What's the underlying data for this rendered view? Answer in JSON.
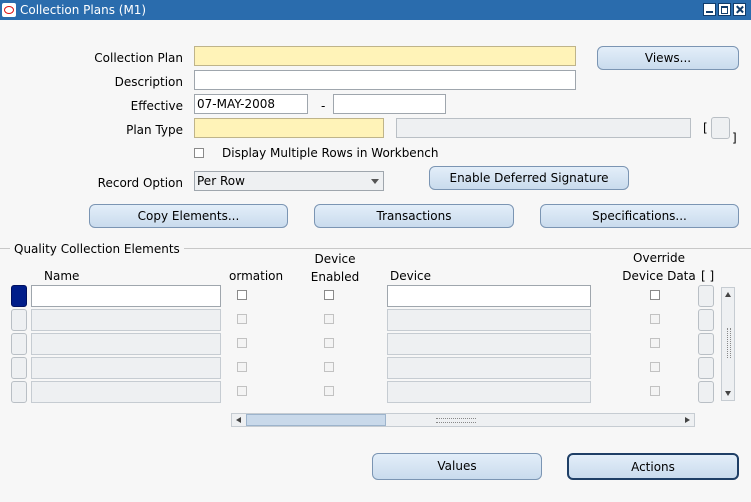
{
  "window": {
    "title": "Collection Plans (M1)"
  },
  "form": {
    "collection_plan_label": "Collection Plan",
    "collection_plan_value": "",
    "description_label": "Description",
    "description_value": "",
    "effective_label": "Effective",
    "effective_from": "07-MAY-2008",
    "effective_dash": "-",
    "effective_to": "",
    "plan_type_label": "Plan Type",
    "plan_type_value": "",
    "plan_type_desc": "",
    "bracket_open": "[",
    "bracket_close": "]",
    "display_multiple_rows_label": "Display Multiple Rows in Workbench",
    "display_multiple_rows_checked": false,
    "record_option_label": "Record Option",
    "record_option_value": "Per Row"
  },
  "buttons": {
    "views": "Views...",
    "enable_deferred_signature": "Enable Deferred Signature",
    "copy_elements": "Copy Elements...",
    "transactions": "Transactions",
    "specifications": "Specifications...",
    "values": "Values",
    "actions": "Actions"
  },
  "elements_section": {
    "title": "Quality Collection Elements",
    "columns": {
      "name": "Name",
      "information": "ormation",
      "device_enabled_1": "Device",
      "device_enabled_2": "Enabled",
      "device": "Device",
      "override_1": "Override",
      "override_2": "Device Data",
      "bracket": "[ ]"
    },
    "rows": [
      {
        "name": "",
        "device": ""
      },
      {
        "name": "",
        "device": ""
      },
      {
        "name": "",
        "device": ""
      },
      {
        "name": "",
        "device": ""
      },
      {
        "name": "",
        "device": ""
      }
    ]
  },
  "colors": {
    "titlebar": "#2a6cad",
    "required": "#fff3b8",
    "button": "#c9dbed",
    "row_active": "#001d8a"
  }
}
